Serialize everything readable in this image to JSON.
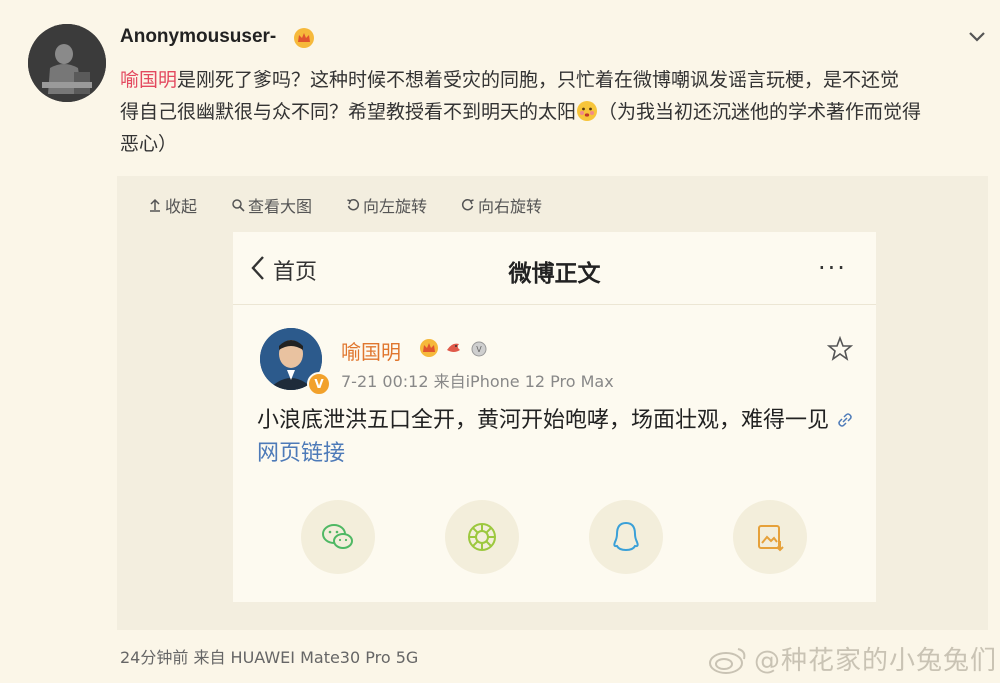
{
  "post": {
    "username": "Anonymoususer-",
    "mention": "喻国明",
    "text_line1_rest": "是刚死了爹吗？这种时候不想着受灾的同胞，只忙着在微博嘲讽发谣言玩梗，是不还觉",
    "text_line2_before_emoji": "得自己很幽默很与众不同？希望教授看不到明天的太阳",
    "text_line2_after_emoji": "（为我当初还沉迷他的学术著作而觉得",
    "text_line3": "恶心）",
    "footer": "24分钟前  来自 HUAWEI Mate30 Pro 5G"
  },
  "toolbar": {
    "collapse": "收起",
    "view_large": "查看大图",
    "rotate_left": "向左旋转",
    "rotate_right": "向右旋转"
  },
  "screenshot": {
    "back_label": "首页",
    "title": "微博正文",
    "more": "···",
    "author": "喻国明",
    "verified_mark": "V",
    "meta": "7-21 00:12  来自iPhone 12 Pro Max",
    "body_text": "小浪底泄洪五口全开，黄河开始咆哮，场面壮观，难得一见",
    "link_text": "网页链接"
  },
  "watermark": {
    "text": "@种花家的小兔兔们"
  },
  "icons": {
    "crown": "crown-icon",
    "chevron": "chevron-down-icon",
    "share": [
      "wechat-icon",
      "moments-icon",
      "qq-icon",
      "save-image-icon"
    ]
  },
  "colors": {
    "background": "#fbf6e8",
    "mention": "#e3495f",
    "author": "#e0762e",
    "link": "#4d7ab8"
  }
}
